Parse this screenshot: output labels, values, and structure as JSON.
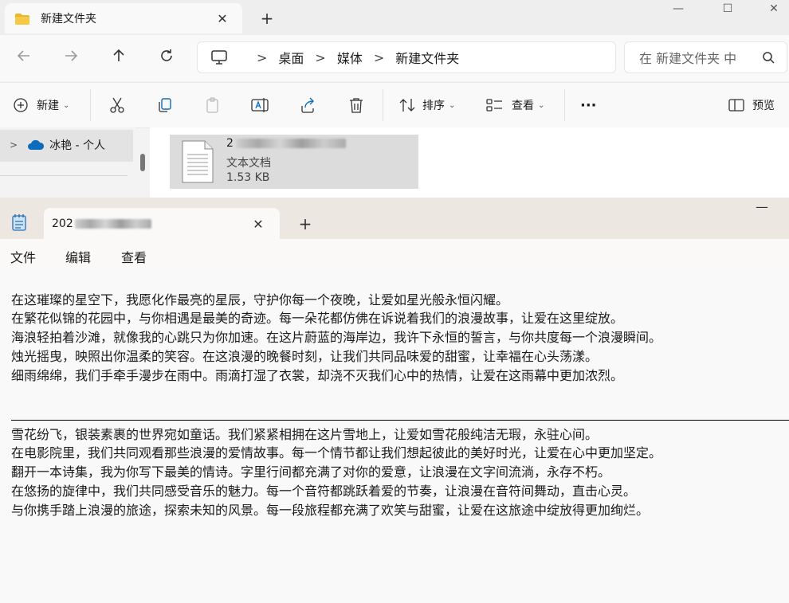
{
  "explorer": {
    "tab_title": "新建文件夹",
    "breadcrumb": [
      "桌面",
      "媒体",
      "新建文件夹"
    ],
    "search_placeholder": "在 新建文件夹 中",
    "commands": {
      "new": "新建",
      "sort": "排序",
      "view": "查看",
      "more": "···",
      "preview": "预览"
    },
    "nav": {
      "item": "冰艳 - 个人"
    },
    "file": {
      "name_prefix": "2",
      "type": "文本文档",
      "size": "1.53 KB"
    }
  },
  "notepad": {
    "tab_title_prefix": "202",
    "menu": [
      "文件",
      "编辑",
      "查看"
    ],
    "paragraph1": [
      "在这璀璨的星空下，我愿化作最亮的星辰，守护你每一个夜晚，让爱如星光般永恒闪耀。",
      "在繁花似锦的花园中，与你相遇是最美的奇迹。每一朵花都仿佛在诉说着我们的浪漫故事，让爱在这里绽放。",
      "海浪轻拍着沙滩，就像我的心跳只为你加速。在这片蔚蓝的海岸边，我许下永恒的誓言，与你共度每一个浪漫瞬间。",
      "烛光摇曳，映照出你温柔的笑容。在这浪漫的晚餐时刻，让我们共同品味爱的甜蜜，让幸福在心头荡漾。",
      "细雨绵绵，我们手牵手漫步在雨中。雨滴打湿了衣裳，却浇不灭我们心中的热情，让爱在这雨幕中更加浓烈。"
    ],
    "paragraph2": [
      "雪花纷飞，银装素裹的世界宛如童话。我们紧紧相拥在这片雪地上，让爱如雪花般纯洁无瑕，永驻心间。",
      "在电影院里，我们共同观看那些浪漫的爱情故事。每一个情节都让我们想起彼此的美好时光，让爱在心中更加坚定。",
      "翻开一本诗集，我为你写下最美的情诗。字里行间都充满了对你的爱意，让浪漫在文字间流淌，永存不朽。",
      "在悠扬的旋律中，我们共同感受音乐的魅力。每一个音符都跳跃着爱的节奏，让浪漫在音符间舞动，直击心灵。",
      "与你携手踏上浪漫的旅途，探索未知的风景。每一段旅程都充满了欢笑与甜蜜，让爱在这旅途中绽放得更加绚烂。"
    ]
  },
  "colors": {
    "folder": "#e8b730",
    "onedrive": "#0f6cbd",
    "notepad_icon": "#2f6fb3"
  }
}
